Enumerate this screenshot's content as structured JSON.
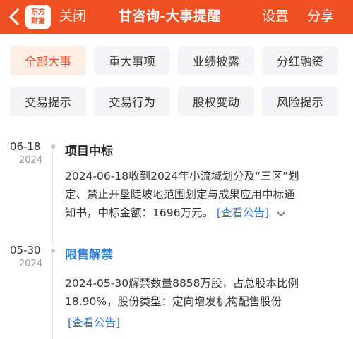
{
  "header": {
    "logo_line1": "东方",
    "logo_line2": "财富",
    "close_label": "关闭",
    "title": "甘咨询-大事提醒",
    "settings_label": "设置",
    "share_label": "分享",
    "accent_color": "#f04f22"
  },
  "filters": {
    "items": [
      {
        "label": "全部大事",
        "active": true
      },
      {
        "label": "重大事项",
        "active": false
      },
      {
        "label": "业绩披露",
        "active": false
      },
      {
        "label": "分红融资",
        "active": false
      },
      {
        "label": "交易提示",
        "active": false
      },
      {
        "label": "交易行为",
        "active": false
      },
      {
        "label": "股权变动",
        "active": false
      },
      {
        "label": "风险提示",
        "active": false
      }
    ]
  },
  "events": [
    {
      "date": "06-18",
      "year": "2024",
      "title": "项目中标",
      "body_line1": "2024-06-18收到2024年小流域划分及“三区”划",
      "body_line2": "定、禁止开垦陡坡地范围划定与成果应用中标通",
      "body_line3": "知书，中标金额：1696万元。",
      "link": "[查看公告]"
    },
    {
      "date": "05-30",
      "year": "2024",
      "title": "限售解禁",
      "body_line1": "2024-05-30解禁数量8858万股，占总股本比例",
      "body_line2": "18.90%，股份类型：定向增发机构配售股份",
      "link": "[查看公告]"
    }
  ]
}
